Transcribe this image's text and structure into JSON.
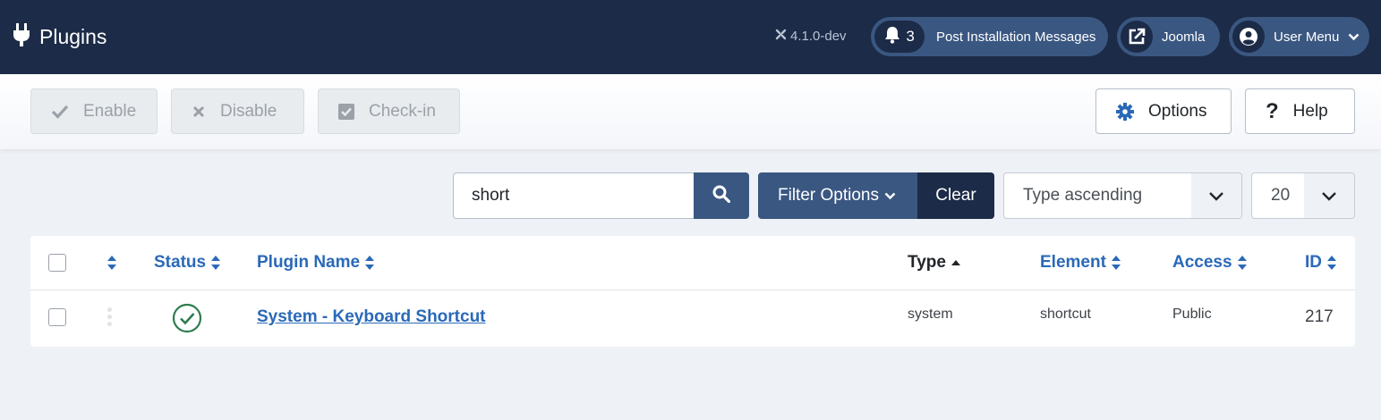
{
  "header": {
    "title": "Plugins",
    "version": "4.1.0-dev",
    "messages_count": "3",
    "messages_label": "Post Installation Messages",
    "joomla_label": "Joomla",
    "user_label": "User Menu"
  },
  "toolbar": {
    "enable_label": "Enable",
    "disable_label": "Disable",
    "checkin_label": "Check-in",
    "options_label": "Options",
    "help_label": "Help"
  },
  "filters": {
    "search_value": "short",
    "filter_options_label": "Filter Options",
    "clear_label": "Clear",
    "ordering_selected": "Type ascending",
    "limit_selected": "20"
  },
  "table": {
    "columns": {
      "status": "Status",
      "name": "Plugin Name",
      "type": "Type",
      "element": "Element",
      "access": "Access",
      "id": "ID"
    },
    "rows": [
      {
        "name": "System - Keyboard Shortcut",
        "type": "system",
        "element": "shortcut",
        "access": "Public",
        "id": "217",
        "status": "enabled"
      }
    ]
  },
  "colors": {
    "header_bg": "#1c2b47",
    "accent": "#3a5781",
    "link": "#2a69b8",
    "success": "#2f7d4f"
  }
}
